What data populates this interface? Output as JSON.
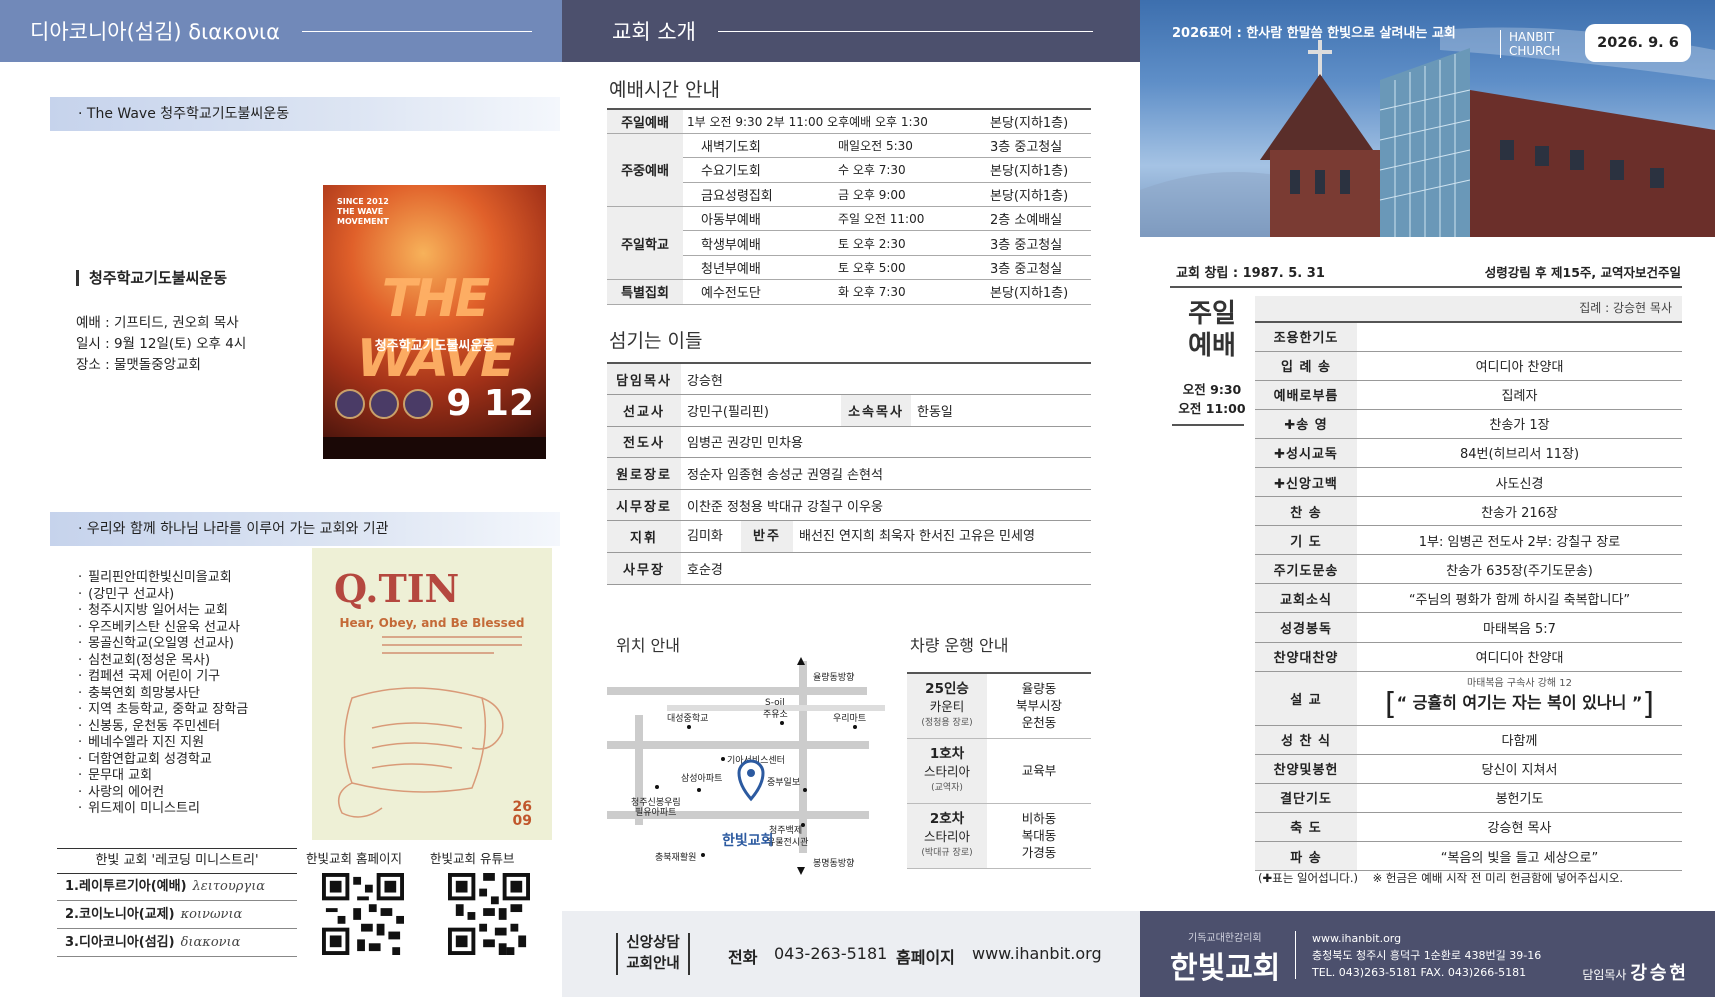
{
  "panel1": {
    "header": "디아코니아(섬김) διακονια",
    "wave_bar": "The Wave 청주학교기도불씨운동",
    "wave_title": "청주학교기도불씨운동",
    "wave_info": [
      "예배 : 기프티드, 권오희 목사",
      "일시 : 9월 12일(토) 오후 4시",
      "장소 : 물맷돌중앙교회"
    ],
    "poster": {
      "top_text": "SINCE 2012\nTHE WAVE\nMOVEMENT",
      "big": "THE WAVE",
      "sub": "청주학교기도불씨운동",
      "date": "9 12"
    },
    "inst_bar": "우리와 함께 하나님 나라를 이루어 가는 교회와 기관",
    "institutions": [
      "필리핀안띠한빛신미을교회",
      "(강민구 선교사)",
      "청주시지방 일어서는 교회",
      "우즈베키스탄 신윤욱 선교사",
      "몽골신학교(오일영 선교사)",
      "심천교회(정성운 목사)",
      "컴페션 국제 어린이 기구",
      "충북연회 희망봉사단",
      "지역 초등학교, 중학교 장학금",
      "신봉동, 운천동 주민센터",
      "베네수엘라 지진 지원",
      "더함연합교회 성경학교",
      "문무대 교회",
      "사랑의 에어컨",
      "위드제이 미니스트리"
    ],
    "qtin": {
      "logo": "Q.TIN",
      "subtitle": "Hear, Obey, and Be Blessed",
      "date": "26\n09"
    },
    "recording": {
      "title": "한빛 교회 '레코딩 미니스트리'",
      "items": [
        {
          "label": "1.레이투르기아(예배)",
          "greek": "λειτουργια"
        },
        {
          "label": "2.코이노니아(교제)",
          "greek": "κοινωνια"
        },
        {
          "label": "3.디아코니아(섬김)",
          "greek": "διακονια"
        }
      ]
    },
    "qr_homepage": "한빛교회 홈페이지",
    "qr_youtube": "한빛교회 유튜브"
  },
  "panel2": {
    "header": "교회 소개",
    "schedule_title": "예배시간 안내",
    "schedule": [
      {
        "cat": "주일예배",
        "name": "1부 오전 9:30  2부 11:00  오후예배 오후 1:30",
        "time": "",
        "place": "본당(지하1층)"
      },
      {
        "cat": "주중예배",
        "name": "새벽기도회",
        "time": "매일오전 5:30",
        "place": "3층 중고청실"
      },
      {
        "cat": "",
        "name": "수요기도회",
        "time": "수 오후 7:30",
        "place": "본당(지하1층)"
      },
      {
        "cat": "",
        "name": "금요성령집회",
        "time": "금 오후 9:00",
        "place": "본당(지하1층)"
      },
      {
        "cat": "주일학교",
        "name": "아동부예배",
        "time": "주일 오전 11:00",
        "place": "2층 소예배실"
      },
      {
        "cat": "",
        "name": "학생부예배",
        "time": "토 오후 2:30",
        "place": "3층 중고청실"
      },
      {
        "cat": "",
        "name": "청년부예배",
        "time": "토 오후 5:00",
        "place": "3층 중고청실"
      },
      {
        "cat": "특별집회",
        "name": "예수전도단",
        "time": "화 오후 7:30",
        "place": "본당(지하1층)"
      }
    ],
    "servers_title": "섬기는 이들",
    "servers": {
      "senior": {
        "label": "담임목사",
        "value": "강승현"
      },
      "missionary": {
        "label": "선교사",
        "value": "강민구(필리핀)"
      },
      "assoc": {
        "label": "소속목사",
        "value": "한동일"
      },
      "evangelist": {
        "label": "전도사",
        "value": "임병곤 권강민 민차용"
      },
      "emeritus": {
        "label": "원로장로",
        "value": "정순자 임종현 송성군 권영길 손현석"
      },
      "active": {
        "label": "시무장로",
        "value": "이찬준 정청용 박대규 강칠구 이우웅"
      },
      "conductor": {
        "label": "지휘",
        "value": "김미화"
      },
      "accomp": {
        "label": "반주",
        "value": "배선진 연지희 최욱자 한서진 고유은 민세영"
      },
      "office": {
        "label": "사무장",
        "value": "호순경"
      }
    },
    "location_title": "위치 안내",
    "map_labels": {
      "north": "율량동방향",
      "school": "대성중학교",
      "gas": "S-oil\n주유소",
      "mart": "우리마트",
      "service": "기아서비스센터",
      "apt": "삼성아파트",
      "ilbo": "중부일보",
      "sinbong": "청주신봉우림\n필유아파트",
      "church": "한빛교회",
      "museum": "청주백제\n유물전시관",
      "welfare": "충북재활원",
      "south": "봉명동방향"
    },
    "bus_title": "차량 운행 안내",
    "bus": [
      {
        "car": "25인승",
        "car2": "카운티",
        "driver": "(정청용 장로)",
        "areas": [
          "율량동",
          "북부시장",
          "운천동"
        ]
      },
      {
        "car": "1호차",
        "car2": "스타리아",
        "driver": "(교역자)",
        "areas": [
          "교육부"
        ]
      },
      {
        "car": "2호차",
        "car2": "스타리아",
        "driver": "(박대규 장로)",
        "areas": [
          "비하동",
          "복대동",
          "가경동"
        ]
      }
    ],
    "footer": {
      "title": "신앙상담\n교회안내",
      "phone_label": "전화",
      "phone": "043-263-5181",
      "web_label": "홈페이지",
      "web": "www.ihanbit.org"
    }
  },
  "panel3": {
    "motto": "2026표어 : 한사람 한말씀 한빛으로 살려내는 교회",
    "hbc": "HANBIT\nCHURCH",
    "date": "2026. 9. 6",
    "founded": "교회 창립 : 1987. 5. 31",
    "sunday": "성령강림 후 제15주, 교역자보건주일",
    "worship_title": "주일\n예배",
    "times": [
      "오전 9:30",
      "오전 11:00"
    ],
    "leader": "집례 : 강승현 목사",
    "order": [
      {
        "k": "조용한기도",
        "v": ""
      },
      {
        "k": "입 례 송",
        "v": "여디디아 찬양대"
      },
      {
        "k": "예배로부름",
        "v": "집례자"
      },
      {
        "k": "✚송    영",
        "v": "찬송가 1장"
      },
      {
        "k": "✚성시교독",
        "v": "84번(히브리서 11장)"
      },
      {
        "k": "✚신앙고백",
        "v": "사도신경"
      },
      {
        "k": "찬    송",
        "v": "찬송가 216장"
      },
      {
        "k": "기    도",
        "v": "1부: 임병곤 전도사  2부: 강칠구 장로"
      },
      {
        "k": "주기도문송",
        "v": "찬송가 635장(주기도문송)"
      },
      {
        "k": "교회소식",
        "v": "“주님의 평화가 함께 하시길 축복합니다”"
      },
      {
        "k": "성경봉독",
        "v": "마태복음 5:7"
      },
      {
        "k": "찬양대찬양",
        "v": "여디디아 찬양대"
      },
      {
        "k": "설    교",
        "v": ""
      },
      {
        "k": "성 찬 식",
        "v": "다함께"
      },
      {
        "k": "찬양및봉헌",
        "v": "당신이 지쳐서"
      },
      {
        "k": "결단기도",
        "v": "봉헌기도"
      },
      {
        "k": "축    도",
        "v": "강승현 목사"
      },
      {
        "k": "파    송",
        "v": "“복음의 빛을 들고 세상으로”"
      }
    ],
    "sermon_series": "마태복음 구속사 강해 12",
    "sermon_title": "“ 긍휼히 여기는 자는 복이 있나니 ”",
    "note": "(✚표는 일어섭니다.)    ※ 헌금은 예배 시작 전 미리 헌금함에 넣어주십시오.",
    "footer": {
      "denomination": "기독교대한감리회",
      "name": "한빛교회",
      "addr1": "www.ihanbit.org",
      "addr2": "충청북도 청주시 흥덕구 1순환로 438번길 39-16",
      "addr3": "TEL. 043)263-5181   FAX. 043)266-5181",
      "pastor_label": "담임목사",
      "pastor": "강승현"
    }
  }
}
